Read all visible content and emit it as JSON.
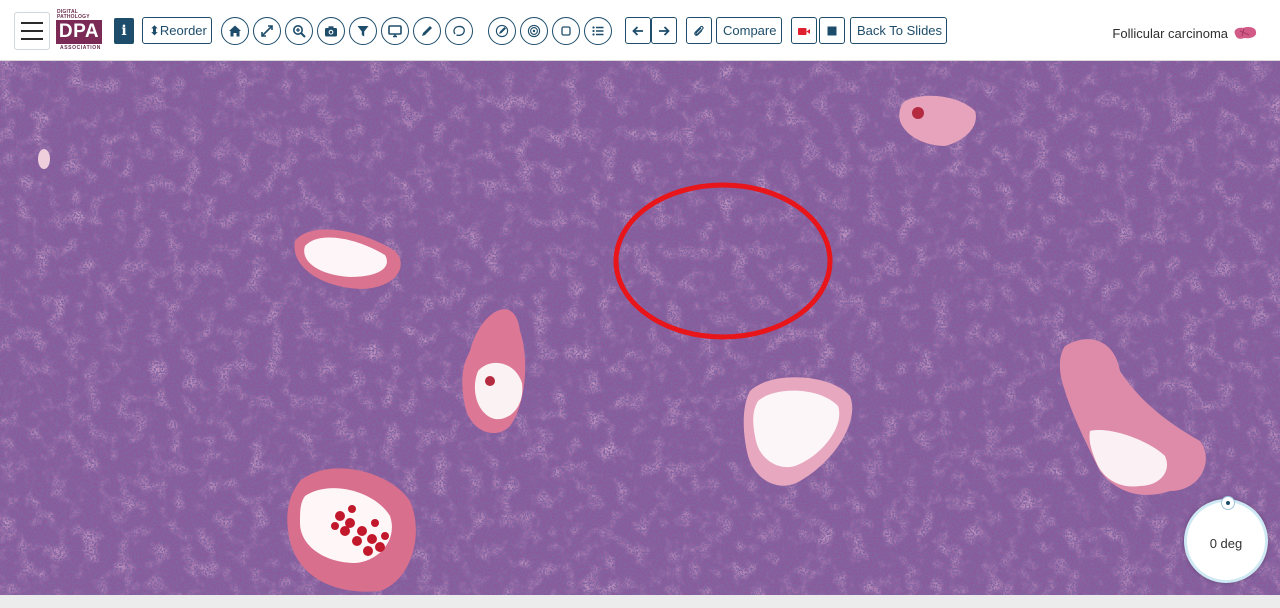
{
  "logo": {
    "top_text": "DIGITAL PATHOLOGY",
    "main_text": "DPA",
    "bottom_text": "ASSOCIATION"
  },
  "toolbar": {
    "info_label": "i",
    "reorder_label": "⬍Reorder",
    "compare_label": "Compare",
    "back_label": "Back To Slides"
  },
  "slide": {
    "title": "Follicular carcinoma"
  },
  "rotation": {
    "label": "0 deg"
  },
  "colors": {
    "accent": "#1e4d6b",
    "annotation": "#e8151b",
    "record": "#e0202e",
    "brand": "#7a2a55"
  }
}
